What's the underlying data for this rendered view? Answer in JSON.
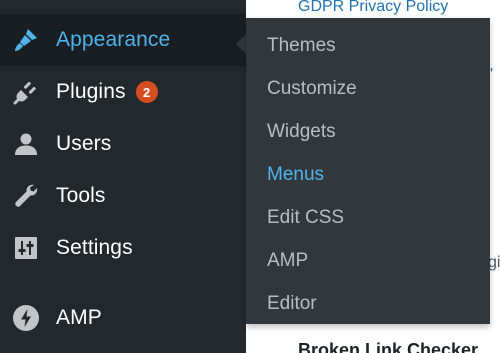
{
  "background": {
    "top_link": "GDPR Privacy Policy",
    "frag_quote": "s'",
    "frag_gi": "gi",
    "bottom_heading": "Broken Link Checker"
  },
  "sidebar": {
    "items": [
      {
        "label": "Appearance",
        "icon": "paintbrush-icon",
        "active": true
      },
      {
        "label": "Plugins",
        "icon": "plug-icon",
        "badge": "2"
      },
      {
        "label": "Users",
        "icon": "user-icon"
      },
      {
        "label": "Tools",
        "icon": "wrench-icon"
      },
      {
        "label": "Settings",
        "icon": "settings-sliders-icon"
      },
      {
        "label": "AMP",
        "icon": "amp-bolt-icon"
      }
    ]
  },
  "submenu": {
    "items": [
      {
        "label": "Themes"
      },
      {
        "label": "Customize"
      },
      {
        "label": "Widgets"
      },
      {
        "label": "Menus",
        "current": true
      },
      {
        "label": "Edit CSS"
      },
      {
        "label": "AMP"
      },
      {
        "label": "Editor"
      }
    ]
  },
  "colors": {
    "sidebar_bg": "#23282d",
    "active_bg": "#191e23",
    "submenu_bg": "#32373c",
    "accent": "#4fb2e8",
    "badge": "#d54e21"
  }
}
